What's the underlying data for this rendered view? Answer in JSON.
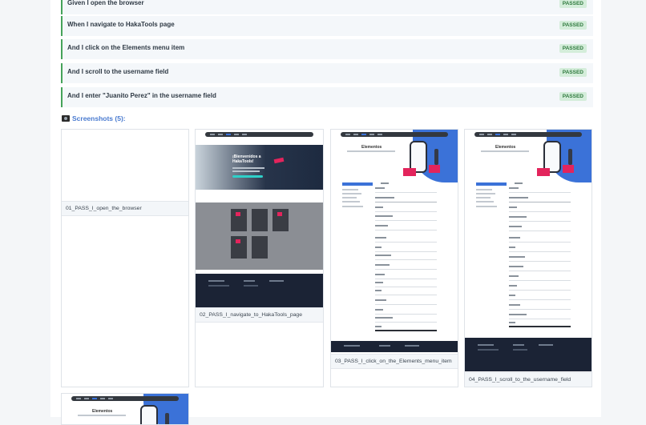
{
  "steps": [
    {
      "text": "Given I open the browser",
      "status": "PASSED"
    },
    {
      "text": "When I navigate to HakaTools page",
      "status": "PASSED"
    },
    {
      "text": "And I click on the Elements menu item",
      "status": "PASSED"
    },
    {
      "text": "And I scroll to the username field",
      "status": "PASSED"
    },
    {
      "text": "And I enter \"Juanito Perez\" in the username field",
      "status": "PASSED"
    }
  ],
  "screenshots_title": "Screenshots (5):",
  "screenshots": [
    {
      "caption": "01_PASS_I_open_the_browser"
    },
    {
      "caption": "02_PASS_I_navigate_to_HakaTools_page",
      "hero_title": "¡Bienvenidos a HakaTools!"
    },
    {
      "caption": "03_PASS_I_click_on_the_Elements_menu_item",
      "heading": "Elementos"
    },
    {
      "caption": "04_PASS_I_scroll_to_the_username_field",
      "heading": "Elementos"
    },
    {
      "caption": "",
      "heading": "Elementos"
    }
  ],
  "colors": {
    "passed_bg": "#d4edda",
    "passed_text": "#2f7a3e",
    "accent": "#4a7bd0",
    "step_border": "#46a35a"
  }
}
